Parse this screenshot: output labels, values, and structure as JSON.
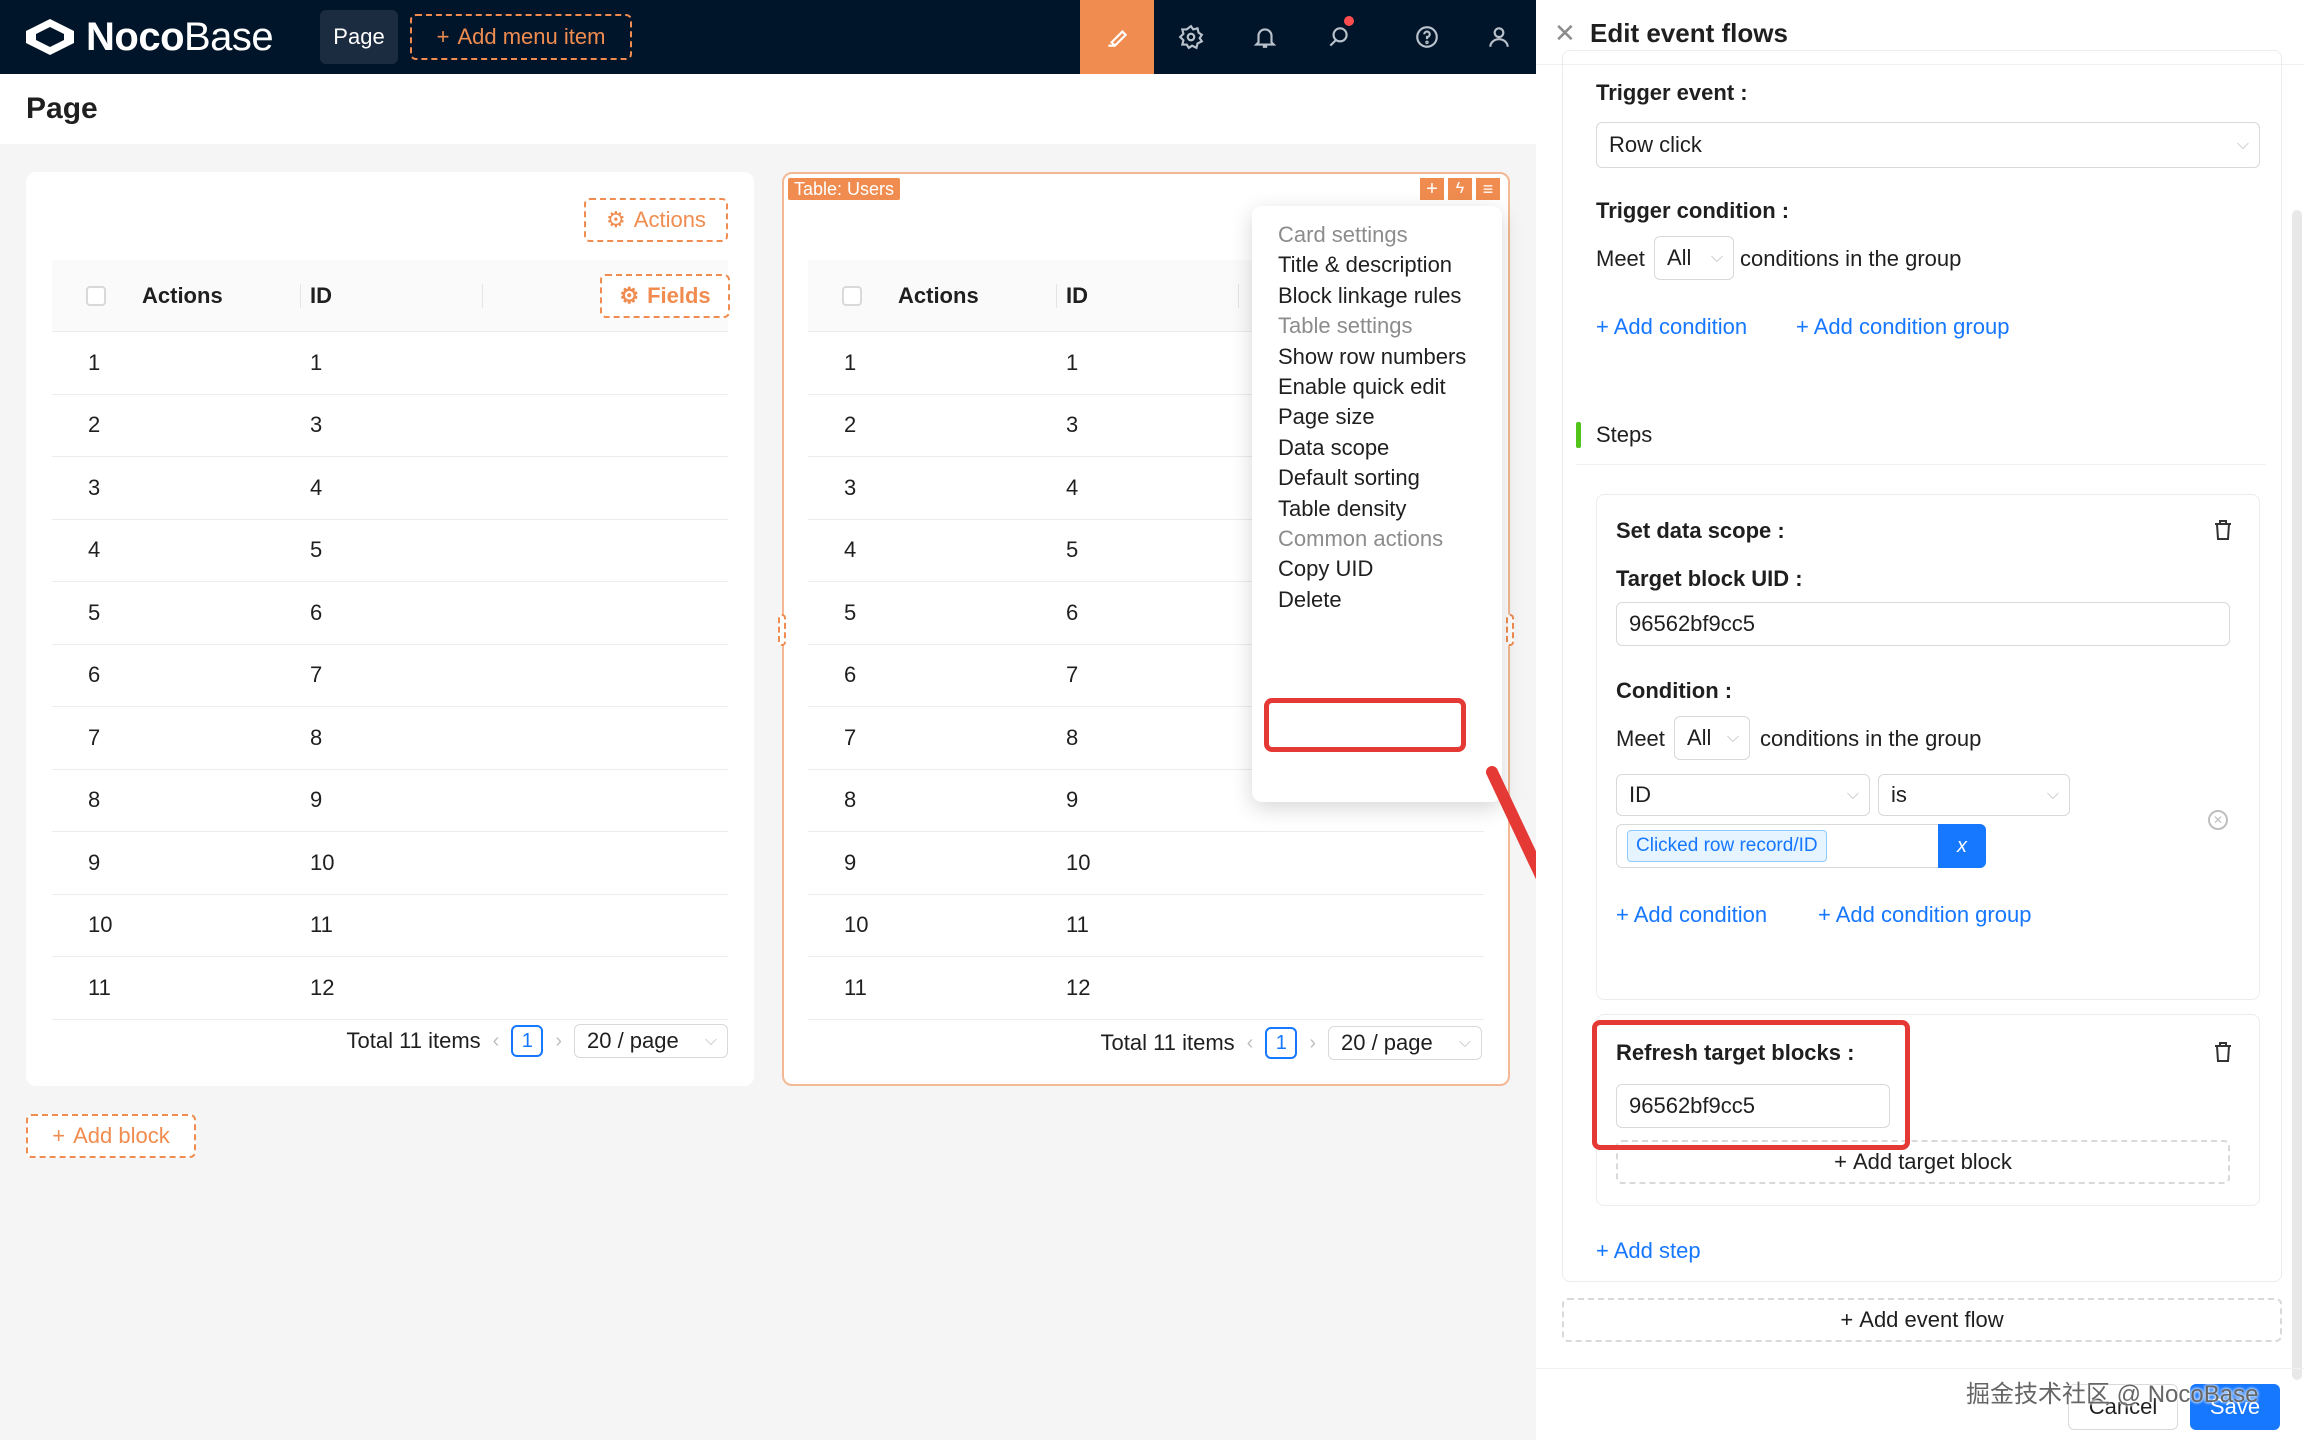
{
  "brand": {
    "name_bold": "Noco",
    "name_light": "Base"
  },
  "topbar": {
    "nav_page": "Page",
    "add_menu_item": "Add menu item",
    "icons": [
      "ui-editor-icon",
      "gear-icon",
      "bell-icon",
      "chat-icon",
      "help-icon",
      "user-icon"
    ]
  },
  "page": {
    "title": "Page",
    "add_block": "Add block"
  },
  "left_table": {
    "actions_button": "Actions",
    "fields_button": "Fields",
    "columns": [
      "Actions",
      "ID"
    ],
    "rows": [
      [
        "1",
        "1"
      ],
      [
        "2",
        "3"
      ],
      [
        "3",
        "4"
      ],
      [
        "4",
        "5"
      ],
      [
        "5",
        "6"
      ],
      [
        "6",
        "7"
      ],
      [
        "7",
        "8"
      ],
      [
        "8",
        "9"
      ],
      [
        "9",
        "10"
      ],
      [
        "10",
        "11"
      ],
      [
        "11",
        "12"
      ]
    ],
    "total": "Total 11 items",
    "current_page": "1",
    "page_size": "20 / page"
  },
  "right_table": {
    "block_tag": "Table: Users",
    "columns": [
      "Actions",
      "ID"
    ],
    "rows": [
      [
        "1",
        "1"
      ],
      [
        "2",
        "3"
      ],
      [
        "3",
        "4"
      ],
      [
        "4",
        "5"
      ],
      [
        "5",
        "6"
      ],
      [
        "6",
        "7"
      ],
      [
        "7",
        "8"
      ],
      [
        "8",
        "9"
      ],
      [
        "9",
        "10"
      ],
      [
        "10",
        "11"
      ],
      [
        "11",
        "12"
      ]
    ],
    "total": "Total 11 items",
    "current_page": "1",
    "page_size": "20 / page"
  },
  "context_menu": {
    "items": [
      {
        "label": "Card settings",
        "group": true
      },
      {
        "label": "Title & description",
        "group": false
      },
      {
        "label": "Block linkage rules",
        "group": false
      },
      {
        "label": "Table settings",
        "group": true
      },
      {
        "label": "Show row numbers",
        "group": false
      },
      {
        "label": "Enable quick edit",
        "group": false
      },
      {
        "label": "Page size",
        "group": false
      },
      {
        "label": "Data scope",
        "group": false
      },
      {
        "label": "Default sorting",
        "group": false
      },
      {
        "label": "Table density",
        "group": false
      },
      {
        "label": "Common actions",
        "group": true
      },
      {
        "label": "Copy UID",
        "group": false
      },
      {
        "label": "Delete",
        "group": false
      }
    ]
  },
  "drawer": {
    "title": "Edit event flows",
    "trigger_event_label": "Trigger event",
    "trigger_event_value": "Row click",
    "trigger_condition_label": "Trigger condition",
    "meet": "Meet",
    "all": "All",
    "conditions_in_group": "conditions in the group",
    "add_condition": "Add condition",
    "add_condition_group": "Add condition group",
    "steps_label": "Steps",
    "set_data_scope": "Set data scope",
    "target_block_uid_label": "Target block UID",
    "target_block_uid_value": "96562bf9cc5",
    "condition_label": "Condition",
    "cond_field": "ID",
    "cond_operator": "is",
    "cond_value_tag": "Clicked row record/ID",
    "var_button": "x",
    "refresh_target_blocks": "Refresh target blocks",
    "refresh_uid_value": "96562bf9cc5",
    "add_target_block": "Add target block",
    "add_step": "Add step",
    "add_event_flow": "Add event flow",
    "cancel": "Cancel",
    "save": "Save"
  },
  "watermark": "掘金技术社区 @ NocoBase",
  "colors": {
    "accent": "#f08c4f",
    "primary": "#1677ff",
    "topbar": "#001529",
    "highlight": "#e53935"
  }
}
